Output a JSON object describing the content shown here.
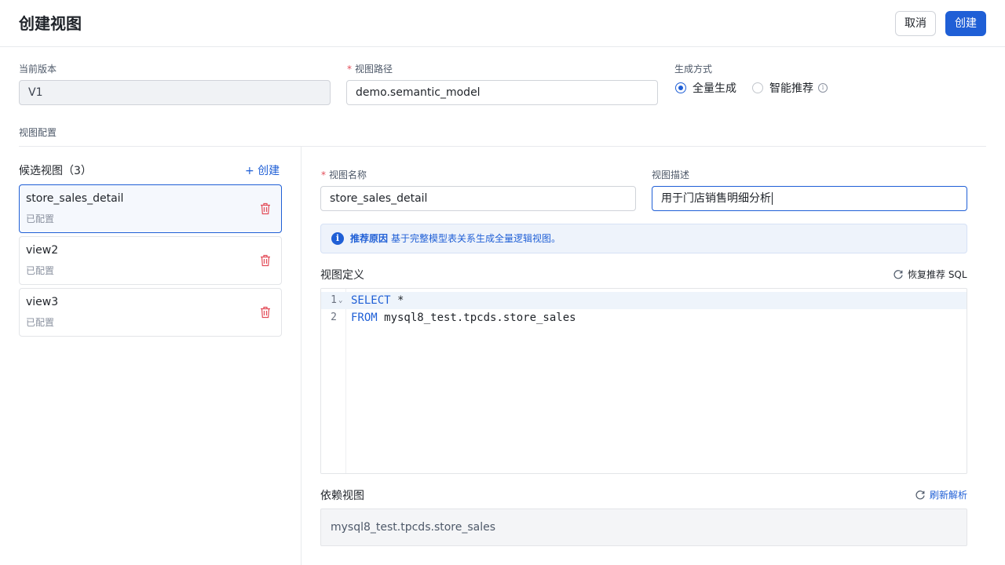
{
  "header": {
    "title": "创建视图",
    "cancel_label": "取消",
    "create_label": "创建"
  },
  "form": {
    "version_label": "当前版本",
    "version_value": "V1",
    "path_required": "*",
    "path_label": "视图路径",
    "path_value": "demo.semantic_model",
    "mode_label": "生成方式",
    "mode_options": [
      {
        "label": "全量生成",
        "checked": true
      },
      {
        "label": "智能推荐",
        "checked": false
      }
    ]
  },
  "section": {
    "title": "视图配置"
  },
  "candidates": {
    "title": "候选视图（3）",
    "add_label": "+ 创建",
    "items": [
      {
        "name": "store_sales_detail",
        "status": "已配置",
        "active": true
      },
      {
        "name": "view2",
        "status": "已配置",
        "active": false
      },
      {
        "name": "view3",
        "status": "已配置",
        "active": false
      }
    ]
  },
  "detail": {
    "name_required": "*",
    "name_label": "视图名称",
    "name_value": "store_sales_detail",
    "desc_label": "视图描述",
    "desc_value": "用于门店销售明细分析",
    "reason_title": "推荐原因",
    "reason_text": "基于完整模型表关系生成全量逻辑视图。",
    "definition_title": "视图定义",
    "restore_label": "恢复推荐 SQL",
    "code_lines": [
      {
        "num": "1",
        "keyword": "SELECT",
        "rest": " *"
      },
      {
        "num": "2",
        "keyword": "FROM",
        "rest": " mysql8_test.tpcds.store_sales"
      }
    ],
    "dependency_title": "依赖视图",
    "refresh_label": "刷新解析",
    "dependency_value": "mysql8_test.tpcds.store_sales"
  },
  "colors": {
    "primary": "#1f5fd6",
    "danger": "#e34d59",
    "border": "#d0d3d9"
  }
}
